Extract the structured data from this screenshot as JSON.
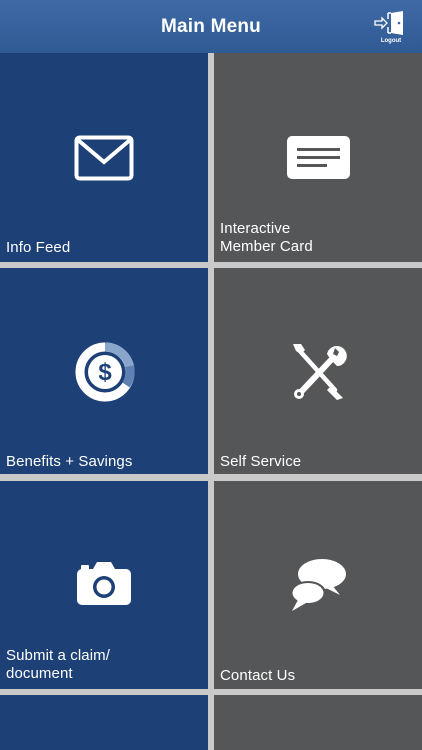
{
  "header": {
    "title": "Main Menu",
    "logout_label": "Logout"
  },
  "tiles": [
    {
      "label": "Info Feed",
      "icon": "envelope-icon",
      "color": "#1d4077"
    },
    {
      "label": "Interactive\nMember Card",
      "icon": "member-card-icon",
      "color": "#555657"
    },
    {
      "label": "Benefits + Savings",
      "icon": "dollar-savings-icon",
      "color": "#1d4077"
    },
    {
      "label": "Self Service",
      "icon": "tools-icon",
      "color": "#555657"
    },
    {
      "label": "Submit a claim/\ndocument",
      "icon": "camera-icon",
      "color": "#1d4077"
    },
    {
      "label": "Contact Us",
      "icon": "chat-bubbles-icon",
      "color": "#555657"
    }
  ],
  "colors": {
    "header": "#3f6aa5",
    "tile_blue": "#1d4077",
    "tile_gray": "#555657",
    "divider": "#c9c9c9"
  }
}
